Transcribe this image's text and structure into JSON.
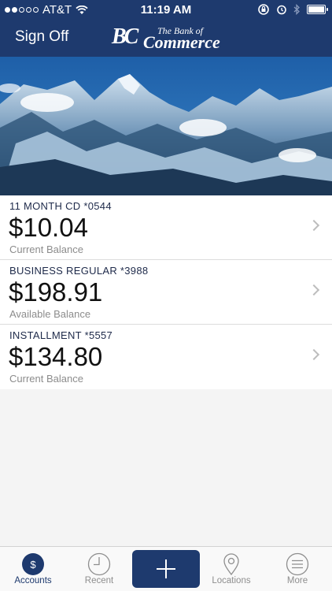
{
  "status_bar": {
    "carrier": "AT&T",
    "time": "11:19 AM"
  },
  "header": {
    "sign_off_label": "Sign Off",
    "logo": {
      "mark": "BC",
      "small_text": "The Bank of",
      "name": "Commerce"
    }
  },
  "accounts": [
    {
      "name": "11 MONTH CD *0544",
      "amount": "$10.04",
      "balance_label": "Current Balance"
    },
    {
      "name": "BUSINESS REGULAR *3988",
      "amount": "$198.91",
      "balance_label": "Available Balance"
    },
    {
      "name": "INSTALLMENT *5557",
      "amount": "$134.80",
      "balance_label": "Current Balance"
    }
  ],
  "tab_bar": {
    "accounts": {
      "label": "Accounts",
      "icon": "dollar-icon"
    },
    "recent": {
      "label": "Recent",
      "icon": "clock-icon"
    },
    "add": {
      "icon": "plus-icon"
    },
    "locations": {
      "label": "Locations",
      "icon": "map-pin-icon"
    },
    "more": {
      "label": "More",
      "icon": "menu-icon"
    }
  },
  "colors": {
    "brand_navy": "#1e3a6e",
    "inactive_gray": "#8e8e8e"
  }
}
